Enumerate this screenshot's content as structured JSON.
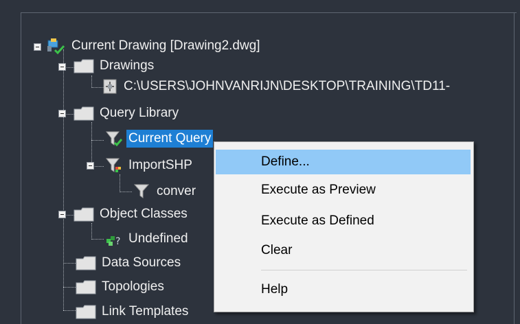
{
  "tree": {
    "root": {
      "label": "Current Drawing [Drawing2.dwg]"
    },
    "drawings": {
      "label": "Drawings"
    },
    "drawing_path": {
      "label": "C:\\USERS\\JOHNVANRIJN\\DESKTOP\\TRAINING\\TD11-"
    },
    "query_library": {
      "label": "Query Library"
    },
    "current_query": {
      "label": "Current Query"
    },
    "import_shp": {
      "label": "ImportSHP"
    },
    "conver": {
      "label": "conver"
    },
    "object_classes": {
      "label": "Object Classes"
    },
    "undefined": {
      "label": "Undefined"
    },
    "data_sources": {
      "label": "Data Sources"
    },
    "topologies": {
      "label": "Topologies"
    },
    "link_templates": {
      "label": "Link Templates"
    }
  },
  "context_menu": {
    "items": [
      {
        "label": "Define..."
      },
      {
        "label": "Execute as Preview"
      },
      {
        "label": "Execute as Defined"
      },
      {
        "label": "Clear"
      },
      {
        "label": "Help"
      }
    ]
  },
  "colors": {
    "background": "#2d333d",
    "selection": "#1e7fd4",
    "menu_highlight": "#91c9f7",
    "folder": "#e3e3e3"
  },
  "icons": [
    "map-explorer-root-icon",
    "folder-icon",
    "drawing-file-icon",
    "query-filter-icon",
    "object-class-icon"
  ]
}
